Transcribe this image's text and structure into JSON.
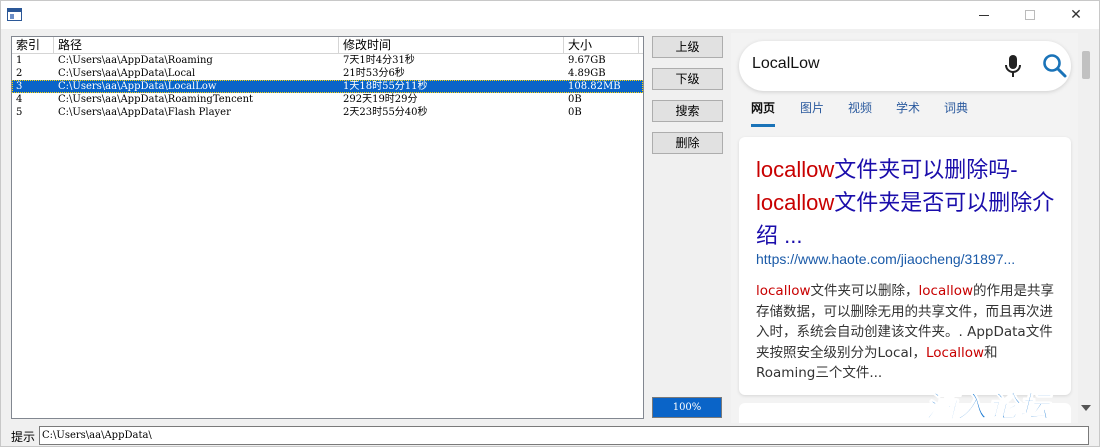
{
  "window": {
    "title": "",
    "min_label": "—",
    "max_label": "☐",
    "close_label": "✕"
  },
  "list": {
    "columns": [
      "索引",
      "路径",
      "修改时间",
      "大小"
    ],
    "rows": [
      {
        "index": "1",
        "path": "C:\\Users\\aa\\AppData\\Roaming",
        "modified": "7天1时4分31秒",
        "size": "9.67GB",
        "selected": false
      },
      {
        "index": "2",
        "path": "C:\\Users\\aa\\AppData\\Local",
        "modified": "21时53分6秒",
        "size": "4.89GB",
        "selected": false
      },
      {
        "index": "3",
        "path": "C:\\Users\\aa\\AppData\\LocalLow",
        "modified": "1天18时55分11秒",
        "size": "108.82MB",
        "selected": true
      },
      {
        "index": "4",
        "path": "C:\\Users\\aa\\AppData\\RoamingTencent",
        "modified": "292天19时29分",
        "size": "0B",
        "selected": false
      },
      {
        "index": "5",
        "path": "C:\\Users\\aa\\AppData\\Flash Player",
        "modified": "2天23时55分40秒",
        "size": "0B",
        "selected": false
      }
    ]
  },
  "buttons": {
    "up": "上级",
    "down": "下级",
    "search": "搜索",
    "delete": "删除"
  },
  "progress": {
    "label": "100%",
    "value": 1.0
  },
  "browser": {
    "query": "LocalLow",
    "tabs": [
      {
        "label": "网页",
        "active": true
      },
      {
        "label": "图片",
        "active": false
      },
      {
        "label": "视频",
        "active": false
      },
      {
        "label": "学术",
        "active": false
      },
      {
        "label": "词典",
        "active": false
      }
    ],
    "result": {
      "title_parts": [
        {
          "text": "locallow",
          "hl": true
        },
        {
          "text": "文件夹可以删除吗-",
          "hl": false
        },
        {
          "text": "locallow",
          "hl": true
        },
        {
          "text": "文件夹是否可以删除介绍 ...",
          "hl": false
        }
      ],
      "url": "https://www.haote.com/jiaocheng/31897...",
      "snippet_parts": [
        {
          "text": "locallow",
          "hl": true
        },
        {
          "text": "文件夹可以删除，",
          "hl": false
        },
        {
          "text": "locallow",
          "hl": true
        },
        {
          "text": "的作用是共享存储数据，可以删除无用的共享文件，而且再次进入时，系统会自动创建该文件夹。. AppData文件夹按照安全级别分为Local，",
          "hl": false
        },
        {
          "text": "Locallow",
          "hl": true
        },
        {
          "text": "和Roaming三个文件...",
          "hl": false
        }
      ]
    },
    "colors": {
      "link": "#1a0dab",
      "highlight": "#c80000",
      "url": "#1a5aa8",
      "accent": "#1a73b8"
    }
  },
  "status": {
    "label": "提示",
    "value": "C:\\Users\\aa\\AppData\\"
  },
  "watermark": "酒入论坛"
}
